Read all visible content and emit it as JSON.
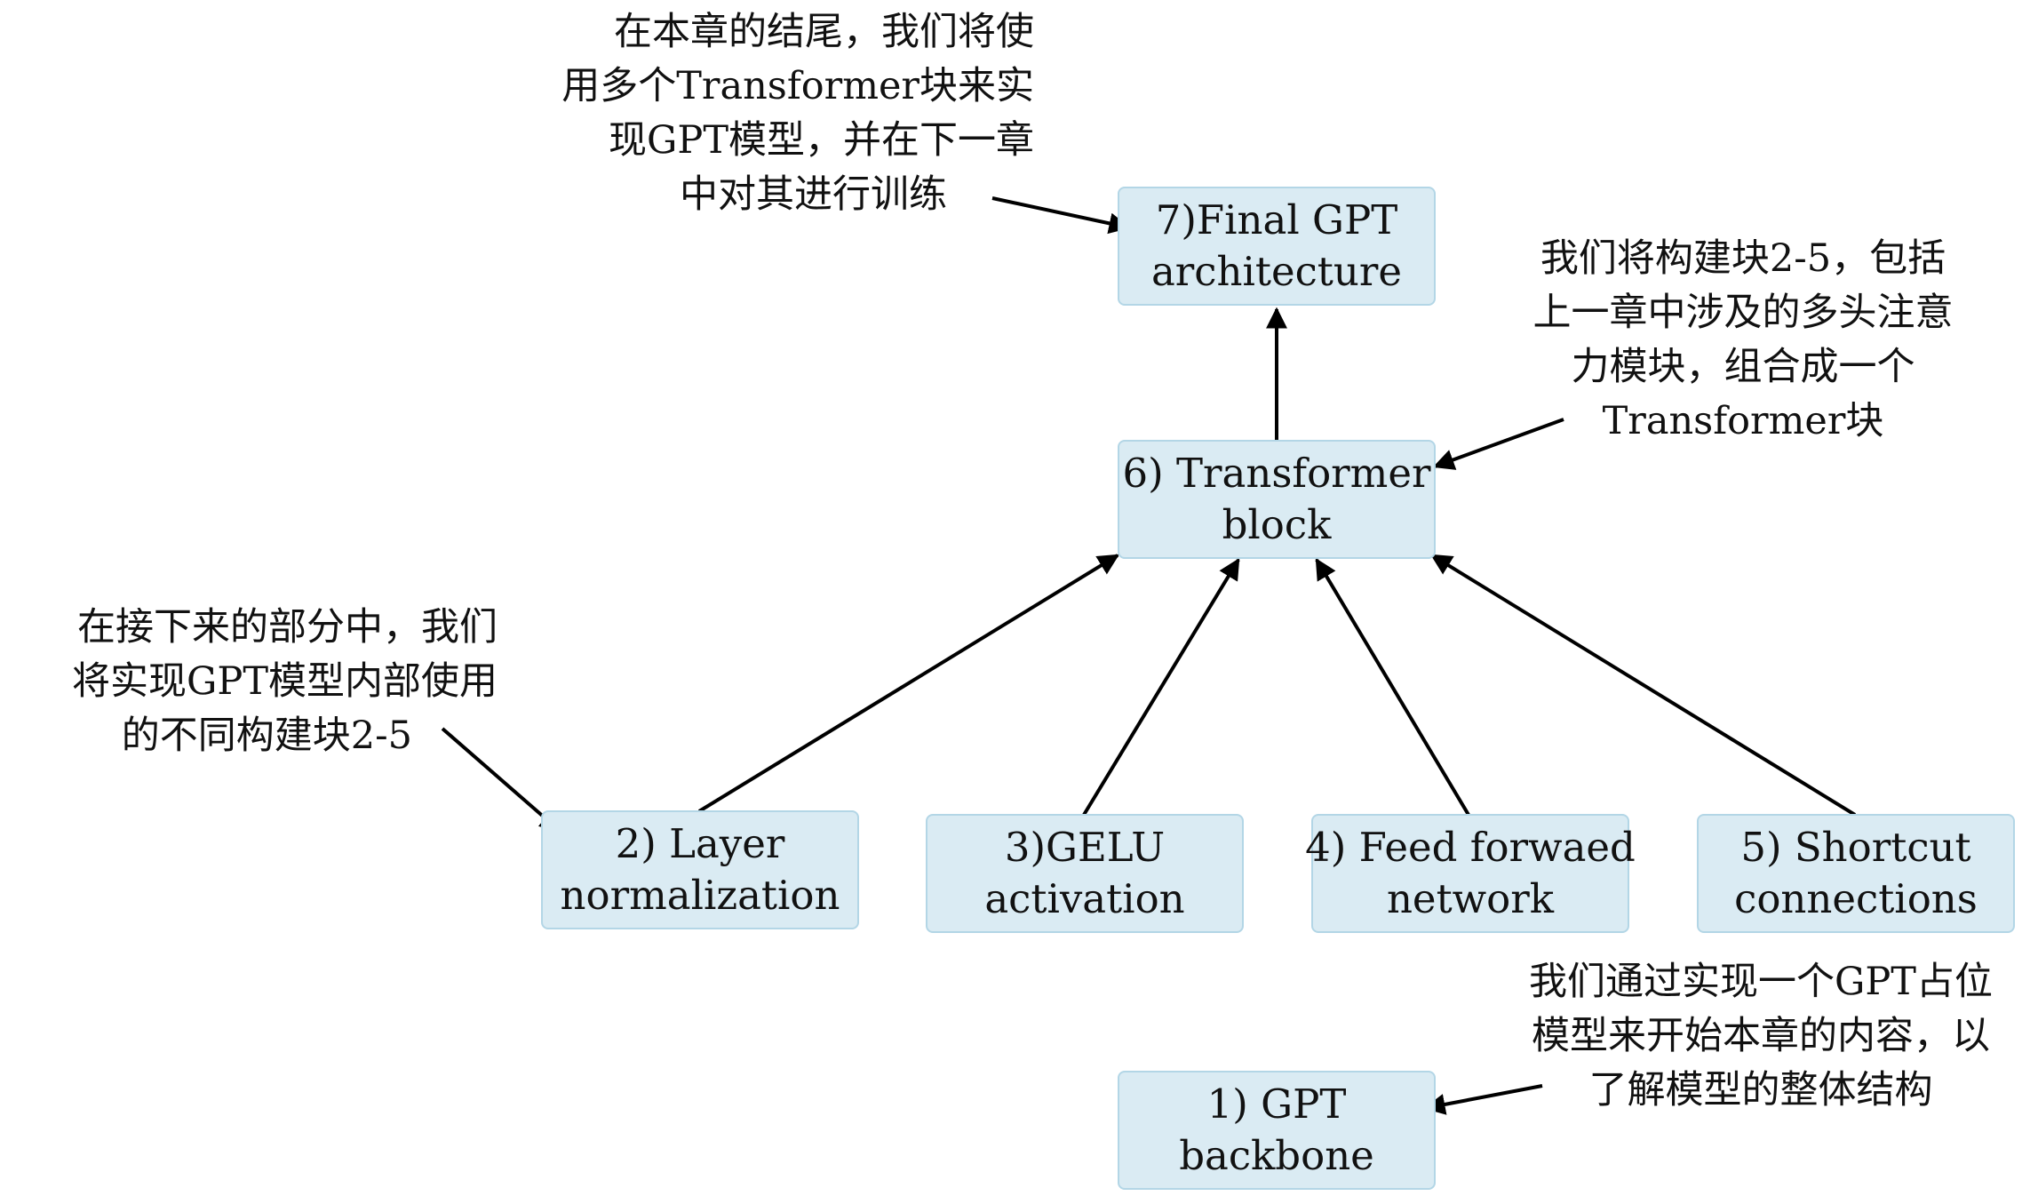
{
  "nodes": {
    "backbone": [
      "1) GPT",
      "backbone"
    ],
    "layernorm": [
      "2) Layer",
      "normalization"
    ],
    "gelu": [
      "3)GELU",
      "activation"
    ],
    "feedforward": [
      "4) Feed forwaed",
      "network"
    ],
    "shortcut": [
      "5) Shortcut",
      "connections"
    ],
    "transformer_block": [
      "6) Transformer",
      "block"
    ],
    "final_gpt": [
      "7)Final GPT",
      "architecture"
    ]
  },
  "notes": {
    "chapter_end": [
      "在本章的结尾，我们将使",
      "用多个Transformer块来实",
      "现GPT模型，并在下一章",
      "中对其进行训练"
    ],
    "build_blocks": [
      "我们将构建块2-5，包括",
      "上一章中涉及的多头注意",
      "力模块，组合成一个",
      "Transformer块"
    ],
    "next_sections": [
      "在接下来的部分中，我们",
      "将实现GPT模型内部使用",
      "的不同构建块2-5"
    ],
    "start_placeholder": [
      "我们通过实现一个GPT占位",
      "模型来开始本章的内容，以",
      "了解模型的整体结构"
    ]
  },
  "colors": {
    "node_fill": "#daebf3",
    "node_border": "#b3d6e6",
    "arrow": "#000000"
  }
}
